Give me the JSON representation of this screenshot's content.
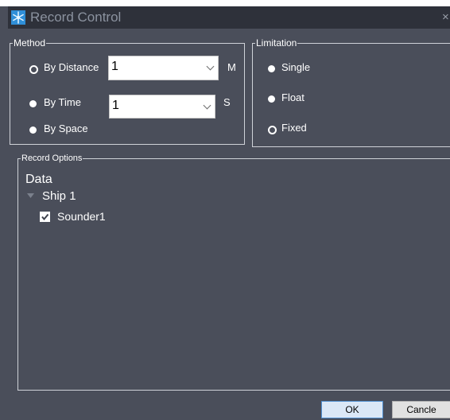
{
  "window": {
    "title": "Record Control",
    "close_glyph": "×"
  },
  "method": {
    "legend": "Method",
    "by_distance": {
      "label": "By Distance",
      "value": "1",
      "unit": "M",
      "selected": true
    },
    "by_time": {
      "label": "By Time",
      "value": "1",
      "unit": "S",
      "selected": false
    },
    "by_space": {
      "label": "By Space",
      "selected": false
    }
  },
  "limitation": {
    "legend": "Limitation",
    "options": [
      {
        "label": "Single",
        "selected": false
      },
      {
        "label": "Float",
        "selected": false
      },
      {
        "label": "Fixed",
        "selected": true
      }
    ]
  },
  "record_options": {
    "legend": "Record Options",
    "tree_root": "Data",
    "ship": "Ship 1",
    "sensor": {
      "label": "Sounder1",
      "checked": true
    }
  },
  "buttons": {
    "ok": "OK",
    "cancel": "Cancle"
  },
  "colors": {
    "background": "#4a4e5a",
    "titlebar": "#2e313a",
    "ok_button": "#dbe8f7"
  },
  "icons": {
    "app": "snowflake-icon",
    "close": "close-icon",
    "tree_toggle": "caret-down-icon",
    "checkbox": "checkmark-icon"
  }
}
